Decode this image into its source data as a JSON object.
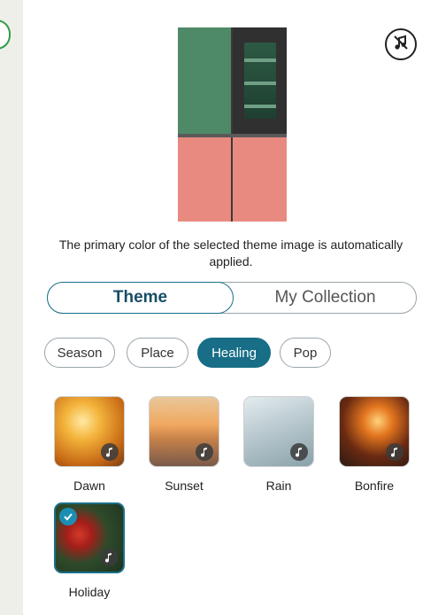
{
  "description": "The primary color of the selected theme image is automatically applied.",
  "tabs": [
    {
      "label": "Theme",
      "active": true
    },
    {
      "label": "My Collection",
      "active": false
    }
  ],
  "chips": [
    {
      "label": "Season",
      "active": false
    },
    {
      "label": "Place",
      "active": false
    },
    {
      "label": "Healing",
      "active": true
    },
    {
      "label": "Pop",
      "active": false
    }
  ],
  "themes": [
    {
      "label": "Dawn",
      "selected": false,
      "icon": "music-note-icon"
    },
    {
      "label": "Sunset",
      "selected": false,
      "icon": "music-note-icon"
    },
    {
      "label": "Rain",
      "selected": false,
      "icon": "music-note-icon"
    },
    {
      "label": "Bonfire",
      "selected": false,
      "icon": "music-note-icon"
    },
    {
      "label": "Holiday",
      "selected": true,
      "icon": "music-note-icon"
    }
  ],
  "colors": {
    "fridge_top": "#4f8a68",
    "fridge_bottom": "#e98a80",
    "accent": "#176e86"
  },
  "icons": {
    "mute": "music-off-icon",
    "selected": "check-icon"
  }
}
